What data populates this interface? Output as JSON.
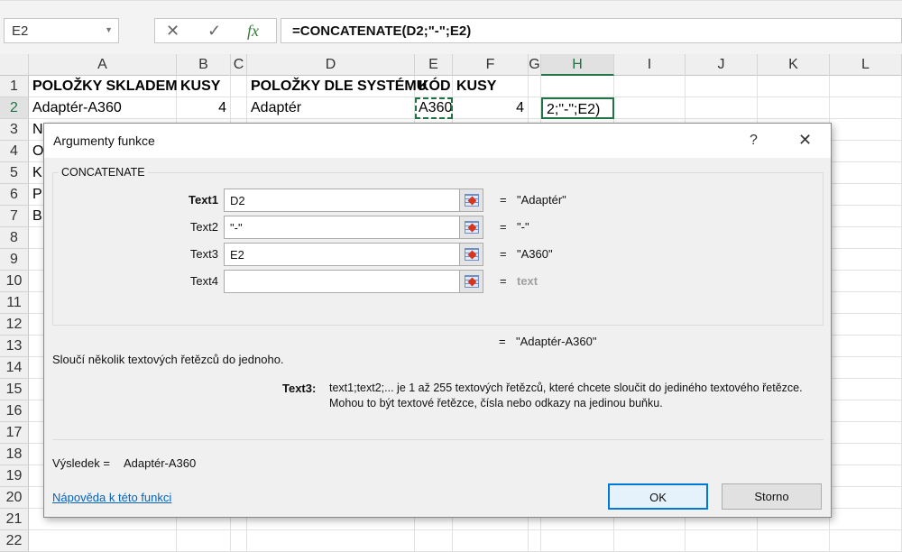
{
  "formula_bar": {
    "name_box": "E2",
    "cancel_icon": "✕",
    "enter_icon": "✓",
    "fx_icon": "fx",
    "formula": "=CONCATENATE(D2;\"-\";E2)"
  },
  "columns": [
    "A",
    "B",
    "C",
    "D",
    "E",
    "F",
    "G",
    "H",
    "I",
    "J",
    "K",
    "L"
  ],
  "rows": [
    "1",
    "2",
    "3",
    "4",
    "5",
    "6",
    "7",
    "8",
    "9",
    "10",
    "11",
    "12",
    "13",
    "14",
    "15",
    "16",
    "17",
    "18",
    "19",
    "20",
    "21",
    "22"
  ],
  "cells": {
    "A1": "POLOŽKY SKLADEM",
    "B1": "KUSY",
    "D1": "POLOŽKY DLE SYSTÉMU",
    "E1": "KÓD",
    "F1": "KUSY",
    "A2": "Adaptér-A360",
    "B2": "4",
    "D2": "Adaptér",
    "E2": "A360",
    "F2": "4",
    "H2": "2;\"-\";E2)",
    "A3": "N",
    "A4": "O",
    "A5": "K",
    "A6": "P",
    "A7": "B"
  },
  "dialog": {
    "title": "Argumenty funkce",
    "help_icon": "?",
    "close_icon": "✕",
    "function_name": "CONCATENATE",
    "args": [
      {
        "label": "Text1",
        "value": "D2",
        "result": "\"Adaptér\"",
        "bold": true
      },
      {
        "label": "Text2",
        "value": "\"-\"",
        "result": "\"-\""
      },
      {
        "label": "Text3",
        "value": "E2",
        "result": "\"A360\""
      },
      {
        "label": "Text4",
        "value": "",
        "result": "text"
      }
    ],
    "eq": "=",
    "formula_result": "\"Adaptér-A360\"",
    "description": "Sloučí několik textových řetězců do jednoho.",
    "arg_name": "Text3:",
    "arg_desc_1": "text1;text2;... je 1 až 255 textových řetězců, které chcete sloučit do jediného textového řetězce.",
    "arg_desc_2": "Mohou to být textové řetězce, čísla nebo odkazy na jedinou buňku.",
    "result_label": "Výsledek =",
    "result_value": "Adaptér-A360",
    "help_link": "Nápověda k této funkci",
    "ok": "OK",
    "cancel": "Storno"
  }
}
